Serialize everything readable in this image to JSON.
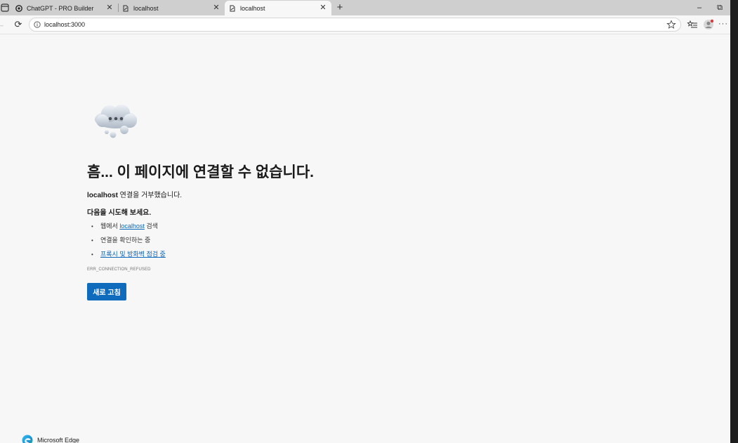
{
  "tabs": [
    {
      "title": "ChatGPT - PRO Builder",
      "icon": "openai-icon",
      "active": false
    },
    {
      "title": "localhost",
      "icon": "page-broken-icon",
      "active": false
    },
    {
      "title": "localhost",
      "icon": "page-broken-icon",
      "active": true
    }
  ],
  "icons": {
    "close": "✕",
    "new_tab": "+",
    "minimize": "–",
    "restore": "⧉",
    "back": "←",
    "reload": "⟳",
    "more": "···"
  },
  "address_bar": {
    "url": "localhost:3000",
    "info_icon": "info-icon",
    "favorite_icon": "star-icon"
  },
  "error_page": {
    "illustration": "thinking-cloud-icon",
    "title": "흠... 이 페이지에 연결할 수 없습니다.",
    "reason_host": "localhost",
    "reason_text": " 연결을 거부했습니다.",
    "suggestions_heading": "다음을 시도해 보세요.",
    "suggestions": {
      "search_prefix": "웹에서 ",
      "search_link": "localhost",
      "search_suffix": " 검색",
      "check_connection": "연결을 확인하는 중",
      "proxy_link": "프록시 및 방화벽 점검 중"
    },
    "error_code": "ERR_CONNECTION_REFUSED",
    "reload_label": "새로 고침"
  },
  "branding": {
    "name": "Microsoft Edge",
    "logo": "edge-logo-icon"
  },
  "colors": {
    "accent": "#0f6cbd",
    "link": "#0a66b8",
    "page_bg": "#f7f7f7",
    "tabstrip_bg": "#cfcfcf"
  }
}
